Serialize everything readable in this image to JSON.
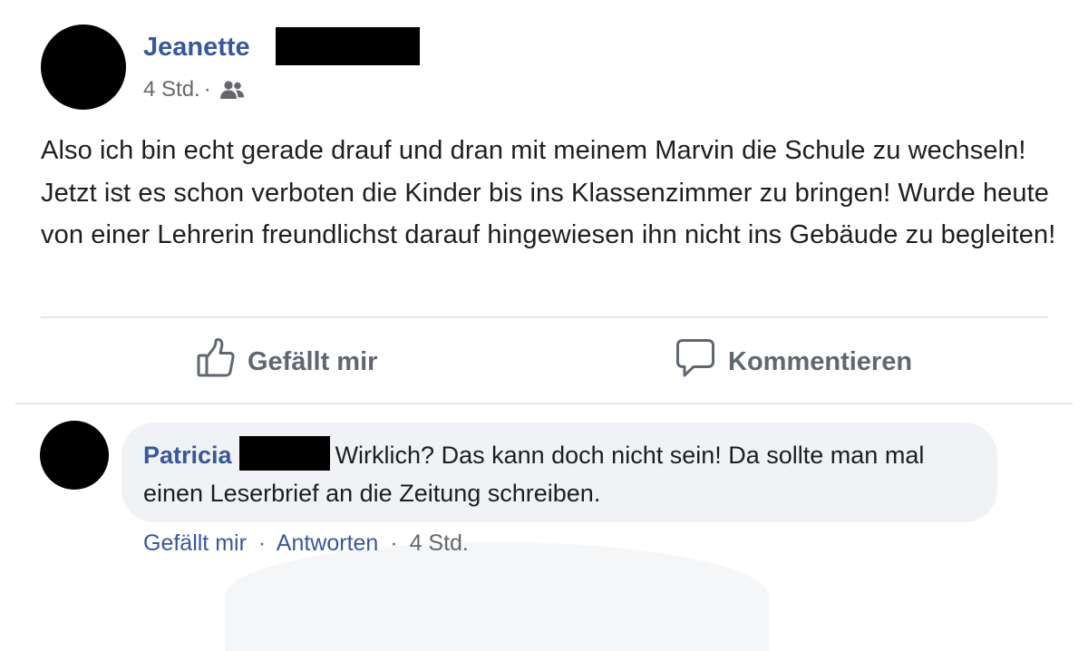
{
  "post": {
    "author_name": "Jeanette",
    "timestamp": "4 Std.",
    "meta_separator": "·",
    "audience_icon": "friends-icon",
    "text": "Also ich bin echt gerade drauf und dran mit meinem Marvin die Schule zu wechseln! Jetzt ist es schon verboten die Kinder bis ins Klassenzimmer zu bringen! Wurde heute von einer Lehrerin freundlichst darauf hingewiesen ihn nicht ins Gebäude zu begleiten!"
  },
  "actions": {
    "like_label": "Gefällt mir",
    "like_icon": "thumbs-up-icon",
    "comment_label": "Kommentieren",
    "comment_icon": "speech-bubble-icon"
  },
  "comment": {
    "author_name": "Patricia",
    "text": "Wirklich? Das kann doch nicht sein! Da sollte man mal einen Leserbrief an die Zeitung schreiben.",
    "like_label": "Gefällt mir",
    "reply_label": "Antworten",
    "separator": "·",
    "timestamp": "4 Std."
  },
  "colors": {
    "name_blue": "#385898",
    "meta_gray": "#65676b",
    "action_gray": "#606770",
    "bubble_bg": "#f0f2f5",
    "divider": "#e4e6eb"
  }
}
